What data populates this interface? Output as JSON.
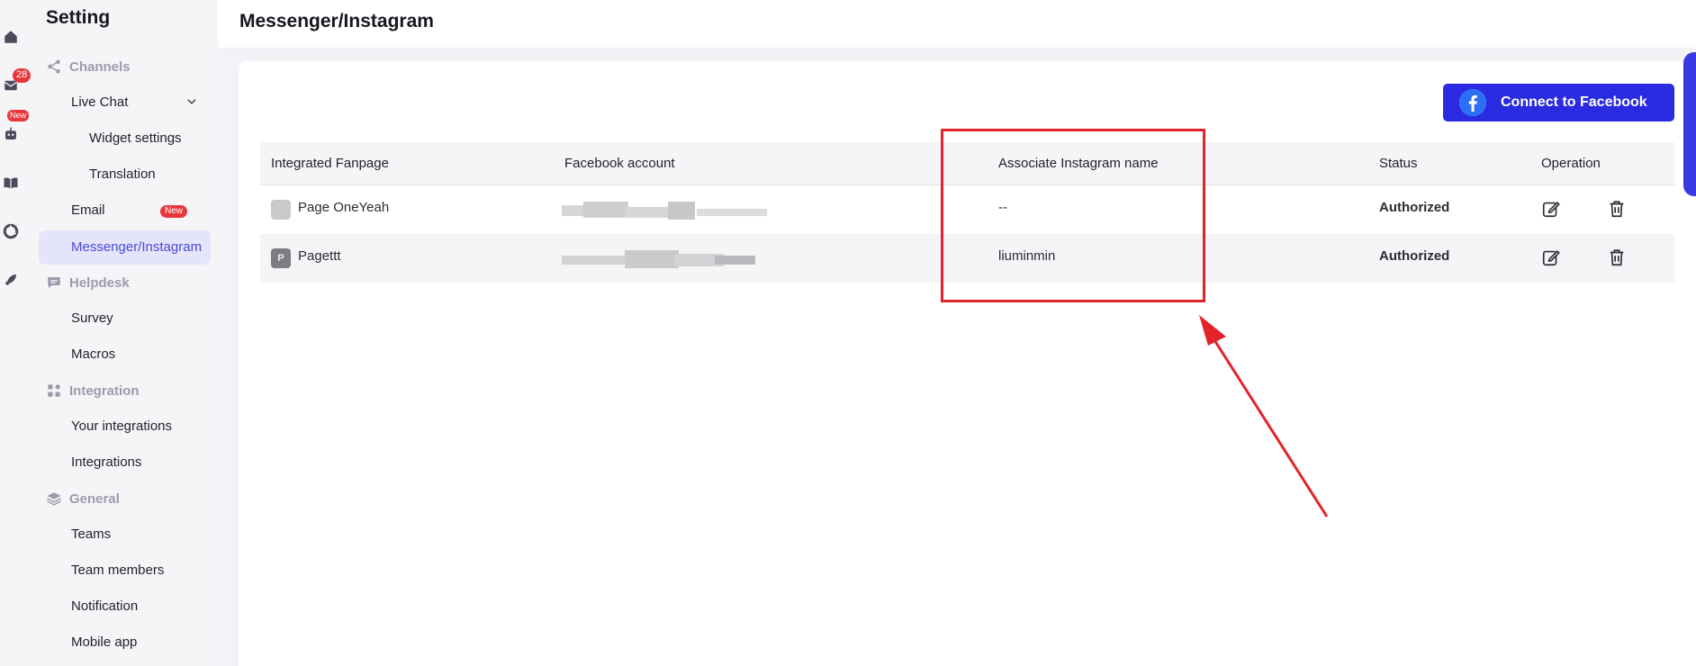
{
  "rail": {
    "badge_count": "28",
    "badge_new": "New",
    "icons": [
      "home-icon",
      "inbox-icon",
      "bot-icon",
      "book-icon",
      "analytics-icon",
      "rocket-icon"
    ]
  },
  "sidebar": {
    "title": "Setting",
    "channels": {
      "label": "Channels",
      "items": {
        "live_chat": "Live Chat",
        "widget_settings": "Widget settings",
        "translation": "Translation",
        "email": "Email",
        "email_badge": "New",
        "messenger": "Messenger/Instagram"
      }
    },
    "helpdesk": {
      "label": "Helpdesk",
      "items": {
        "survey": "Survey",
        "macros": "Macros"
      }
    },
    "integration": {
      "label": "Integration",
      "items": {
        "your_integrations": "Your integrations",
        "integrations": "Integrations"
      }
    },
    "general": {
      "label": "General",
      "items": {
        "teams": "Teams",
        "team_members": "Team members",
        "notification": "Notification",
        "mobile_app": "Mobile app"
      }
    }
  },
  "page": {
    "title": "Messenger/Instagram",
    "connect_button": "Connect to Facebook"
  },
  "table": {
    "headers": {
      "fanpage": "Integrated Fanpage",
      "facebook_account": "Facebook account",
      "instagram": "Associate Instagram name",
      "status": "Status",
      "operation": "Operation"
    },
    "rows": [
      {
        "avatar": "",
        "fanpage": "Page OneYeah",
        "instagram": "--",
        "status": "Authorized"
      },
      {
        "avatar": "P",
        "fanpage": "Pagettt",
        "instagram": "liuminmin",
        "status": "Authorized"
      }
    ]
  },
  "colors": {
    "accent": "#2a2ae0",
    "authorized": "#45c03e",
    "annotation": "#e3232b",
    "badge": "#e8383d"
  }
}
